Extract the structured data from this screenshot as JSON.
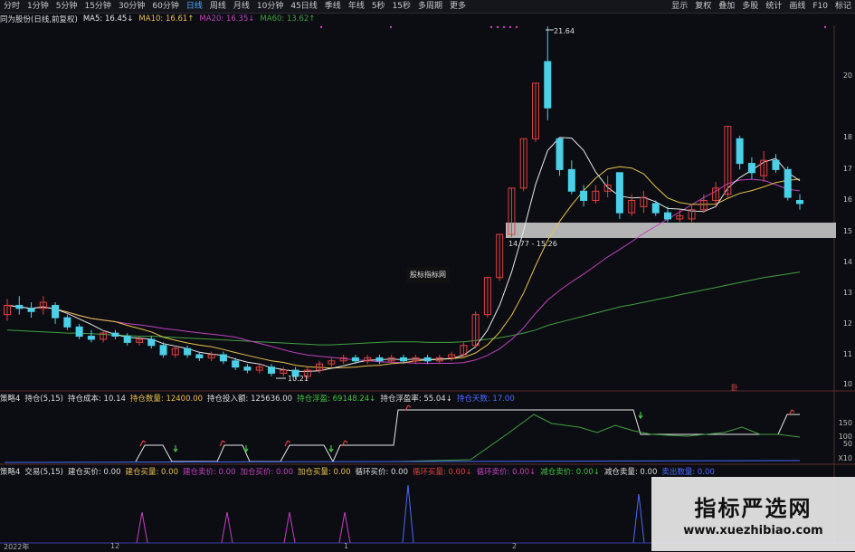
{
  "toolbar": {
    "left": [
      "分时",
      "1分钟",
      "5分钟",
      "15分钟",
      "30分钟",
      "60分钟",
      "日线",
      "周线",
      "月线",
      "10分钟",
      "45日线",
      "季线",
      "年线",
      "5秒",
      "15秒",
      "多周期",
      "更多"
    ],
    "active": "日线",
    "right": [
      "显示",
      "复权",
      "叠加",
      "多股",
      "统计",
      "画线",
      "F10",
      "标记"
    ]
  },
  "legend": {
    "stock": "同为股份(日线,前复权)",
    "ma5": "MA5: 16.45↓",
    "ma10": "MA10: 16.61↑",
    "ma20": "MA20: 16.35↓",
    "ma60": "MA60: 13.62↑"
  },
  "colors": {
    "ma5": "#e6e6e6",
    "ma10": "#e8c04a",
    "ma20": "#c040c0",
    "ma60": "#40a040",
    "up": "#e04040",
    "down": "#4ad0e8"
  },
  "main": {
    "high_label": "21.64",
    "low_label": "10.21",
    "band_label": "14.77 - 15.26",
    "logo_text": "股标指标网",
    "marker": "卧",
    "yticks": [
      "20",
      "18",
      "17",
      "16",
      "15",
      "14",
      "13",
      "12",
      "11",
      "10"
    ]
  },
  "panel1": {
    "title": "策略4",
    "items": [
      "持仓(5,15)",
      "持仓成本: 10.14",
      "持仓数量: 12400.00",
      "持仓投入额: 125636.00",
      "持仓浮盈: 69148.24↓",
      "持仓浮盈率: 55.04↓",
      "持仓天数: 17.00"
    ],
    "yticks": [
      "150",
      "100",
      "50",
      "X10"
    ]
  },
  "panel2": {
    "title": "策略4",
    "items": [
      "交易(5,15)",
      "建仓买价: 0.00",
      "建仓买量: 0.00",
      "建仓卖价: 0.00",
      "加仓买价: 0.00",
      "加仓买量: 0.00",
      "循环买价: 0.00",
      "循环买量: 0.00↓",
      "循环卖价: 0.00↓",
      "减仓卖价: 0.00↓",
      "减仓卖量: 0.00",
      "卖出数量: 0.00"
    ]
  },
  "xaxis": {
    "labels": [
      "2022年",
      "12",
      "1",
      "2"
    ]
  },
  "watermark": {
    "title": "指标严选网",
    "url": "www.xuezhibiao.com"
  },
  "chart_data": {
    "type": "candlestick",
    "title": "同为股份(日线,前复权)",
    "ylim": [
      10,
      22
    ],
    "candles": [
      {
        "o": 12.3,
        "c": 12.6,
        "h": 12.8,
        "l": 12.1
      },
      {
        "o": 12.6,
        "c": 12.5,
        "h": 12.9,
        "l": 12.3
      },
      {
        "o": 12.5,
        "c": 12.4,
        "h": 12.7,
        "l": 12.2
      },
      {
        "o": 12.5,
        "c": 12.7,
        "h": 12.9,
        "l": 12.3
      },
      {
        "o": 12.6,
        "c": 12.2,
        "h": 12.7,
        "l": 12.0
      },
      {
        "o": 12.2,
        "c": 11.9,
        "h": 12.3,
        "l": 11.8
      },
      {
        "o": 11.9,
        "c": 11.6,
        "h": 12.0,
        "l": 11.5
      },
      {
        "o": 11.6,
        "c": 11.5,
        "h": 11.8,
        "l": 11.4
      },
      {
        "o": 11.5,
        "c": 11.7,
        "h": 11.8,
        "l": 11.4
      },
      {
        "o": 11.7,
        "c": 11.6,
        "h": 11.8,
        "l": 11.5
      },
      {
        "o": 11.6,
        "c": 11.4,
        "h": 11.7,
        "l": 11.3
      },
      {
        "o": 11.4,
        "c": 11.5,
        "h": 11.6,
        "l": 11.3
      },
      {
        "o": 11.5,
        "c": 11.3,
        "h": 11.6,
        "l": 11.2
      },
      {
        "o": 11.3,
        "c": 11.0,
        "h": 11.4,
        "l": 10.9
      },
      {
        "o": 11.0,
        "c": 11.2,
        "h": 11.3,
        "l": 10.9
      },
      {
        "o": 11.2,
        "c": 11.0,
        "h": 11.3,
        "l": 10.9
      },
      {
        "o": 11.0,
        "c": 10.9,
        "h": 11.1,
        "l": 10.8
      },
      {
        "o": 10.9,
        "c": 11.0,
        "h": 11.1,
        "l": 10.8
      },
      {
        "o": 11.0,
        "c": 10.8,
        "h": 11.1,
        "l": 10.7
      },
      {
        "o": 10.8,
        "c": 10.6,
        "h": 10.9,
        "l": 10.5
      },
      {
        "o": 10.6,
        "c": 10.5,
        "h": 10.7,
        "l": 10.4
      },
      {
        "o": 10.5,
        "c": 10.6,
        "h": 10.7,
        "l": 10.4
      },
      {
        "o": 10.6,
        "c": 10.4,
        "h": 10.7,
        "l": 10.3
      },
      {
        "o": 10.4,
        "c": 10.5,
        "h": 10.6,
        "l": 10.3
      },
      {
        "o": 10.5,
        "c": 10.3,
        "h": 10.6,
        "l": 10.21
      },
      {
        "o": 10.3,
        "c": 10.5,
        "h": 10.6,
        "l": 10.2
      },
      {
        "o": 10.5,
        "c": 10.7,
        "h": 10.8,
        "l": 10.4
      },
      {
        "o": 10.7,
        "c": 10.8,
        "h": 10.9,
        "l": 10.6
      },
      {
        "o": 10.8,
        "c": 10.9,
        "h": 11.0,
        "l": 10.7
      },
      {
        "o": 10.9,
        "c": 10.8,
        "h": 11.0,
        "l": 10.7
      },
      {
        "o": 10.8,
        "c": 10.9,
        "h": 11.0,
        "l": 10.7
      },
      {
        "o": 10.9,
        "c": 10.8,
        "h": 11.0,
        "l": 10.7
      },
      {
        "o": 10.8,
        "c": 10.9,
        "h": 11.0,
        "l": 10.7
      },
      {
        "o": 10.9,
        "c": 10.8,
        "h": 11.0,
        "l": 10.7
      },
      {
        "o": 10.8,
        "c": 10.9,
        "h": 11.0,
        "l": 10.7
      },
      {
        "o": 10.9,
        "c": 10.8,
        "h": 11.0,
        "l": 10.7
      },
      {
        "o": 10.8,
        "c": 10.9,
        "h": 11.0,
        "l": 10.7
      },
      {
        "o": 10.9,
        "c": 11.0,
        "h": 11.1,
        "l": 10.8
      },
      {
        "o": 11.0,
        "c": 11.3,
        "h": 11.4,
        "l": 10.9
      },
      {
        "o": 11.3,
        "c": 12.3,
        "h": 12.4,
        "l": 11.2
      },
      {
        "o": 12.3,
        "c": 13.5,
        "h": 13.5,
        "l": 12.2
      },
      {
        "o": 13.5,
        "c": 14.9,
        "h": 14.9,
        "l": 13.4
      },
      {
        "o": 14.9,
        "c": 16.4,
        "h": 16.4,
        "l": 14.8
      },
      {
        "o": 16.4,
        "c": 18.0,
        "h": 18.0,
        "l": 16.3
      },
      {
        "o": 18.0,
        "c": 19.8,
        "h": 19.8,
        "l": 17.9
      },
      {
        "o": 20.5,
        "c": 19.0,
        "h": 21.64,
        "l": 18.6
      },
      {
        "o": 18.0,
        "c": 17.0,
        "h": 18.0,
        "l": 16.8
      },
      {
        "o": 17.0,
        "c": 16.3,
        "h": 17.3,
        "l": 16.2
      },
      {
        "o": 16.3,
        "c": 16.0,
        "h": 16.5,
        "l": 15.8
      },
      {
        "o": 16.0,
        "c": 16.3,
        "h": 16.5,
        "l": 15.9
      },
      {
        "o": 16.3,
        "c": 16.5,
        "h": 16.8,
        "l": 16.1
      },
      {
        "o": 16.9,
        "c": 15.6,
        "h": 16.9,
        "l": 15.4
      },
      {
        "o": 15.6,
        "c": 16.0,
        "h": 16.2,
        "l": 15.5
      },
      {
        "o": 15.8,
        "c": 16.1,
        "h": 16.3,
        "l": 15.6
      },
      {
        "o": 15.9,
        "c": 15.6,
        "h": 16.0,
        "l": 15.5
      },
      {
        "o": 15.6,
        "c": 15.4,
        "h": 15.8,
        "l": 15.3
      },
      {
        "o": 15.4,
        "c": 15.5,
        "h": 15.7,
        "l": 15.3
      },
      {
        "o": 15.4,
        "c": 15.7,
        "h": 15.9,
        "l": 15.3
      },
      {
        "o": 15.7,
        "c": 16.0,
        "h": 16.2,
        "l": 15.6
      },
      {
        "o": 16.0,
        "c": 16.4,
        "h": 16.6,
        "l": 15.8
      },
      {
        "o": 16.2,
        "c": 18.4,
        "h": 18.4,
        "l": 16.1
      },
      {
        "o": 18.0,
        "c": 17.2,
        "h": 18.1,
        "l": 17.0
      },
      {
        "o": 17.2,
        "c": 16.9,
        "h": 17.4,
        "l": 16.7
      },
      {
        "o": 16.8,
        "c": 17.3,
        "h": 17.6,
        "l": 16.6
      },
      {
        "o": 17.3,
        "c": 17.0,
        "h": 17.5,
        "l": 16.9
      },
      {
        "o": 17.0,
        "c": 16.1,
        "h": 17.1,
        "l": 16.0
      },
      {
        "o": 16.0,
        "c": 15.9,
        "h": 16.2,
        "l": 15.7
      }
    ],
    "series": [
      {
        "name": "MA60",
        "values": [
          11.8,
          11.78,
          11.76,
          11.74,
          11.72,
          11.7,
          11.7,
          11.68,
          11.66,
          11.64,
          11.62,
          11.6,
          11.6,
          11.58,
          11.56,
          11.54,
          11.52,
          11.5,
          11.48,
          11.46,
          11.44,
          11.42,
          11.4,
          11.38,
          11.36,
          11.34,
          11.32,
          11.32,
          11.34,
          11.36,
          11.38,
          11.4,
          11.42,
          11.42,
          11.42,
          11.4,
          11.4,
          11.4,
          11.42,
          11.46,
          11.5,
          11.55,
          11.62,
          11.7,
          11.8,
          11.95,
          12.05,
          12.15,
          12.25,
          12.35,
          12.45,
          12.55,
          12.62,
          12.7,
          12.78,
          12.86,
          12.94,
          13.02,
          13.1,
          13.18,
          13.26,
          13.34,
          13.42,
          13.5,
          13.56,
          13.62,
          13.68
        ]
      }
    ]
  }
}
